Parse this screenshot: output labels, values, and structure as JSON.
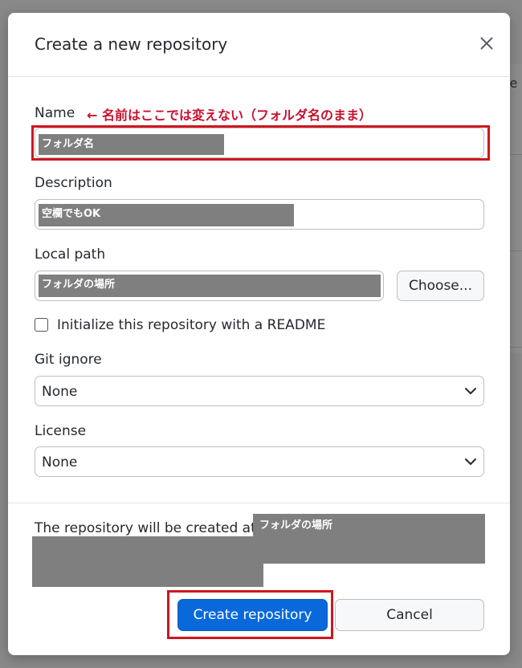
{
  "background": {
    "partial_text": "ie"
  },
  "dialog": {
    "title": "Create a new repository",
    "close_icon": "close-icon"
  },
  "name": {
    "label": "Name",
    "annotation": "← 名前はここでは変えない（フォルダ名のまま）",
    "value": "フォルダ名"
  },
  "description": {
    "label": "Description",
    "value": "空欄でもOK"
  },
  "local_path": {
    "label": "Local path",
    "value": "フォルダの場所",
    "choose_label": "Choose..."
  },
  "readme": {
    "label": "Initialize this repository with a README",
    "checked": false
  },
  "git_ignore": {
    "label": "Git ignore",
    "selected": "None"
  },
  "license": {
    "label": "License",
    "selected": "None"
  },
  "footer": {
    "created_at_text": "The repository will be created at",
    "created_at_value": "フォルダの場所",
    "create_label": "Create repository",
    "cancel_label": "Cancel"
  },
  "colors": {
    "primary_button": "#0969da",
    "highlight": "#d0161f",
    "annotation": "#c8102e",
    "redaction": "#7f7f7f"
  }
}
